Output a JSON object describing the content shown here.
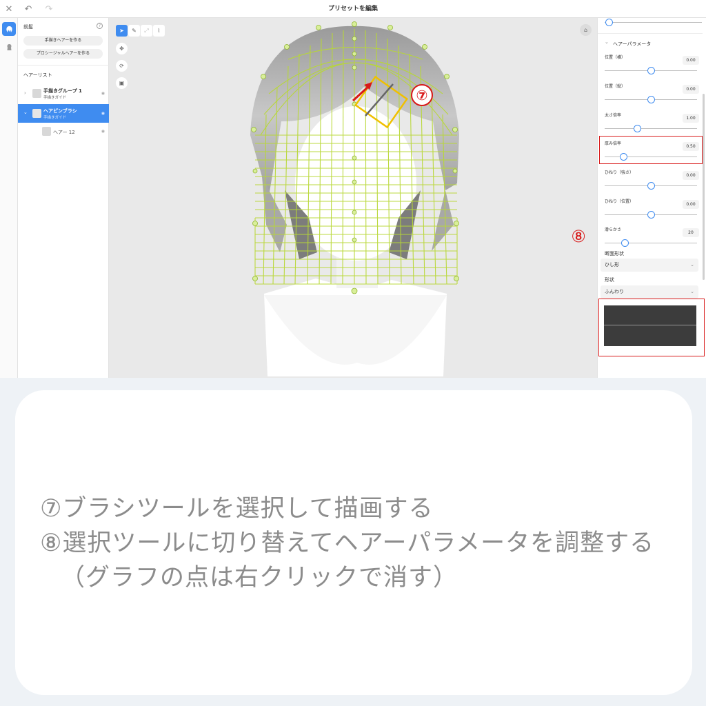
{
  "window": {
    "title": "プリセットを編集"
  },
  "sidebar": {
    "section_title": "前髪",
    "create_hand_button": "手描きヘアーを作る",
    "create_procedural_button": "プロシージャルヘアーを作る",
    "hair_list_label": "ヘアーリスト",
    "items": [
      {
        "name": "手描きグループ 1",
        "sub": "手描きガイド",
        "selected": false
      },
      {
        "name": "ヘアピンブラシ",
        "sub": "手描きガイド",
        "selected": true
      },
      {
        "name": "ヘアー 12",
        "sub": "",
        "selected": false
      }
    ]
  },
  "annotations": {
    "n7": "⑦",
    "n8": "⑧"
  },
  "right_panel": {
    "section_title": "ヘアーパラメータ",
    "params": [
      {
        "label": "位置（横）",
        "value": "0.00",
        "slider": 0.5
      },
      {
        "label": "位置（縦）",
        "value": "0.00",
        "slider": 0.5
      },
      {
        "label": "太さ倍率",
        "value": "1.00",
        "slider": 0.35
      },
      {
        "label": "厚み倍率",
        "value": "0.50",
        "slider": 0.2
      },
      {
        "label": "ひねり（強さ）",
        "value": "0.00",
        "slider": 0.5
      },
      {
        "label": "ひねり（位置）",
        "value": "0.00",
        "slider": 0.5
      },
      {
        "label": "滑らかさ",
        "value": "20",
        "slider": 0.22
      }
    ],
    "cross_section_label": "断面形状",
    "cross_section_value": "ひし形",
    "shape_label": "形状",
    "shape_value": "ふんわり"
  },
  "instructions": {
    "line1": "⑦ブラシツールを選択して描画する",
    "line2": "⑧選択ツールに切り替えてヘアーパラメータを調整する",
    "line3": "（グラフの点は右クリックで消す）"
  },
  "colors": {
    "accent": "#3f8cf0",
    "annotation_red": "#d81818",
    "guide_yellow": "#f0c000",
    "mesh_green": "#b8d835"
  }
}
